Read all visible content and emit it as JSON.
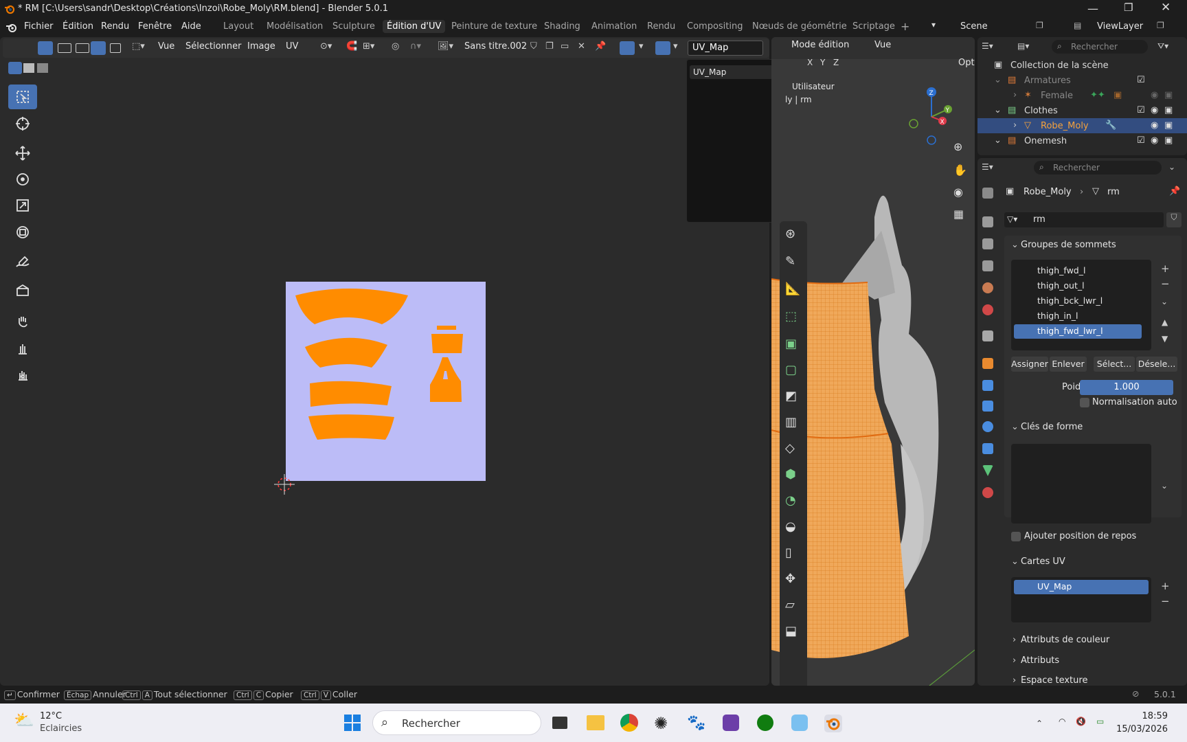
{
  "window": {
    "title": "* RM [C:\\Users\\sandr\\Desktop\\Créations\\Inzoi\\Robe_Moly\\RM.blend] - Blender 5.0.1"
  },
  "menu": [
    "Fichier",
    "Édition",
    "Rendu",
    "Fenêtre",
    "Aide"
  ],
  "workspaces": [
    "Layout",
    "Modélisation",
    "Sculpture",
    "Édition d'UV",
    "Peinture de texture",
    "Shading",
    "Animation",
    "Rendu",
    "Compositing",
    "Nœuds de géométrie",
    "Scriptage"
  ],
  "active_workspace": "Édition d'UV",
  "scene": "Scene",
  "view_layer": "ViewLayer",
  "uv_header": {
    "menus": [
      "Vue",
      "Sélectionner",
      "Image",
      "UV"
    ],
    "image_name": "Sans titre.002",
    "uv_map_field": "UV_Map"
  },
  "uv_dropdown": {
    "items": [
      "UV_Map"
    ]
  },
  "viewport": {
    "mode": "Mode édition",
    "view_label": "Vue",
    "options": "Opti",
    "axes": [
      "X",
      "Y",
      "Z"
    ],
    "overlay_text_1": "Utilisateur",
    "overlay_text_2": "ly | rm"
  },
  "outliner": {
    "search_placeholder": "Rechercher",
    "items": [
      {
        "label": "Collection de la scène",
        "indent": 0
      },
      {
        "label": "Armatures",
        "indent": 1
      },
      {
        "label": "Female",
        "indent": 2
      },
      {
        "label": "Clothes",
        "indent": 1
      },
      {
        "label": "Robe_Moly",
        "indent": 2
      },
      {
        "label": "Onemesh",
        "indent": 1
      }
    ]
  },
  "properties": {
    "search_placeholder": "Rechercher",
    "breadcrumb_object": "Robe_Moly",
    "breadcrumb_mesh": "rm",
    "mesh_name": "rm",
    "vertex_groups_title": "Groupes de sommets",
    "vertex_groups": [
      "thigh_fwd_l",
      "thigh_out_l",
      "thigh_bck_lwr_l",
      "thigh_in_l",
      "thigh_fwd_lwr_l"
    ],
    "buttons": [
      "Assigner",
      "Enlever",
      "Sélect...",
      "Désele..."
    ],
    "weight_label": "Poids",
    "weight_value": "1.000",
    "auto_normalize": "Normalisation auto",
    "shape_keys_title": "Clés de forme",
    "rest_position": "Ajouter position de repos",
    "uv_maps_title": "Cartes UV",
    "uv_map_item": "UV_Map",
    "color_attributes": "Attributs de couleur",
    "attributes": "Attributs",
    "texture_space": "Espace texture"
  },
  "status_bar": {
    "confirm": "Confirmer",
    "cancel_key": "Échap",
    "cancel": "Annuler",
    "select_all": "Tout sélectionner",
    "copy": "Copier",
    "paste": "Coller",
    "version": "5.0.1"
  },
  "taskbar": {
    "temperature": "12°C",
    "weather": "Eclaircies",
    "search_placeholder": "Rechercher",
    "time": "18:59",
    "date": "15/03/2026"
  },
  "colors": {
    "accent": "#4772b3",
    "uv_island": "#ff8c00",
    "uv_background": "#bcbcf7",
    "mesh_wire": "#f5a23c"
  }
}
